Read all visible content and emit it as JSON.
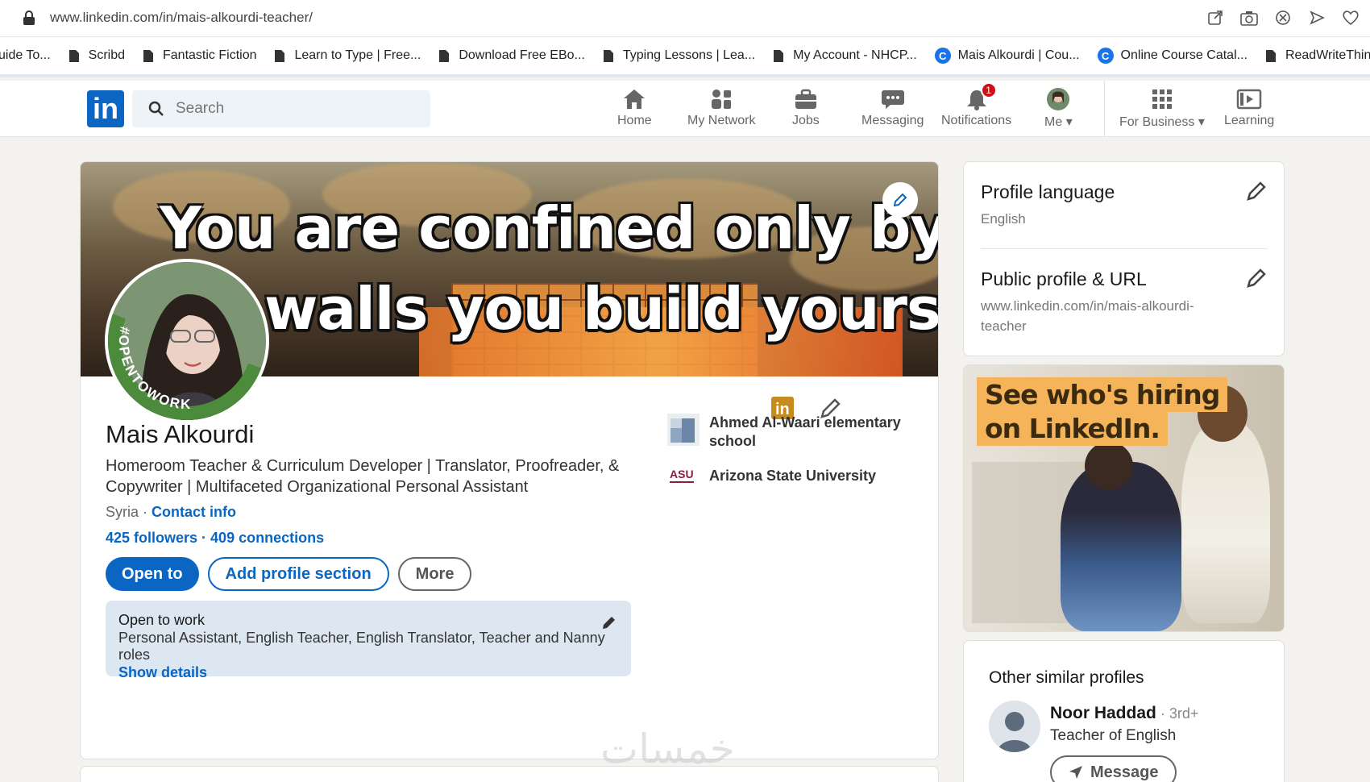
{
  "browser": {
    "url": "www.linkedin.com/in/mais-alkourdi-teacher/",
    "icons": [
      "share-icon",
      "camera-icon",
      "block-icon",
      "send-icon",
      "heart-icon"
    ]
  },
  "bookmarks": [
    {
      "label": "uide To...",
      "icon": "page"
    },
    {
      "label": "Scribd",
      "icon": "page"
    },
    {
      "label": "Fantastic Fiction",
      "icon": "page"
    },
    {
      "label": "Learn to Type | Free...",
      "icon": "page"
    },
    {
      "label": "Download Free EBo...",
      "icon": "page"
    },
    {
      "label": "Typing Lessons | Lea...",
      "icon": "page"
    },
    {
      "label": "My Account - NHCP...",
      "icon": "page"
    },
    {
      "label": "Mais Alkourdi | Cou...",
      "icon": "coursera"
    },
    {
      "label": "Online Course Catal...",
      "icon": "coursera"
    },
    {
      "label": "ReadWriteThink - R...",
      "icon": "page"
    }
  ],
  "nav": {
    "logo": "in",
    "search_placeholder": "Search",
    "items": {
      "home": "Home",
      "network": "My Network",
      "jobs": "Jobs",
      "messaging": "Messaging",
      "notifications": "Notifications",
      "me": "Me",
      "business": "For Business",
      "learning": "Learning"
    },
    "notification_count": "1"
  },
  "profile": {
    "banner_quote_line1": "You are confined only by",
    "banner_quote_line2": "walls you build yourself.",
    "avatar_ring_text": "#OPENTOWORK",
    "name": "Mais Alkourdi",
    "headline": "Homeroom Teacher & Curriculum Developer | Translator, Proofreader, & Copywriter | Multifaceted Organizational Personal Assistant",
    "location": "Syria",
    "separator": " · ",
    "contact_info": "Contact info",
    "followers": "425 followers",
    "connections": "409 connections",
    "buttons": {
      "open_to": "Open to",
      "add_section": "Add profile section",
      "more": "More"
    },
    "experience": [
      {
        "name": "Ahmed Al-Waari elementary school"
      },
      {
        "name": "Arizona State University",
        "logo_text": "ASU"
      }
    ],
    "open_to_work": {
      "title": "Open to work",
      "roles": "Personal Assistant, English Teacher, English Translator, Teacher and Nanny roles",
      "show_details": "Show details"
    }
  },
  "sidebar": {
    "profile_language_title": "Profile language",
    "profile_language_value": "English",
    "public_profile_title": "Public profile & URL",
    "public_profile_value": "www.linkedin.com/in/mais-alkourdi-teacher",
    "ad_line1": "See who's hiring",
    "ad_line2": "on LinkedIn.",
    "similar_title": "Other similar profiles",
    "similar_name": "Noor Haddad",
    "similar_degree": " · 3rd+",
    "similar_role": "Teacher of English",
    "similar_button": "Message"
  },
  "watermark": "خمسات",
  "colors": {
    "linkedin_blue": "#0a66c2",
    "page_bg": "#f3f2ef",
    "open_to_work_green": "#4b8b3b",
    "notification_red": "#cc1016"
  }
}
